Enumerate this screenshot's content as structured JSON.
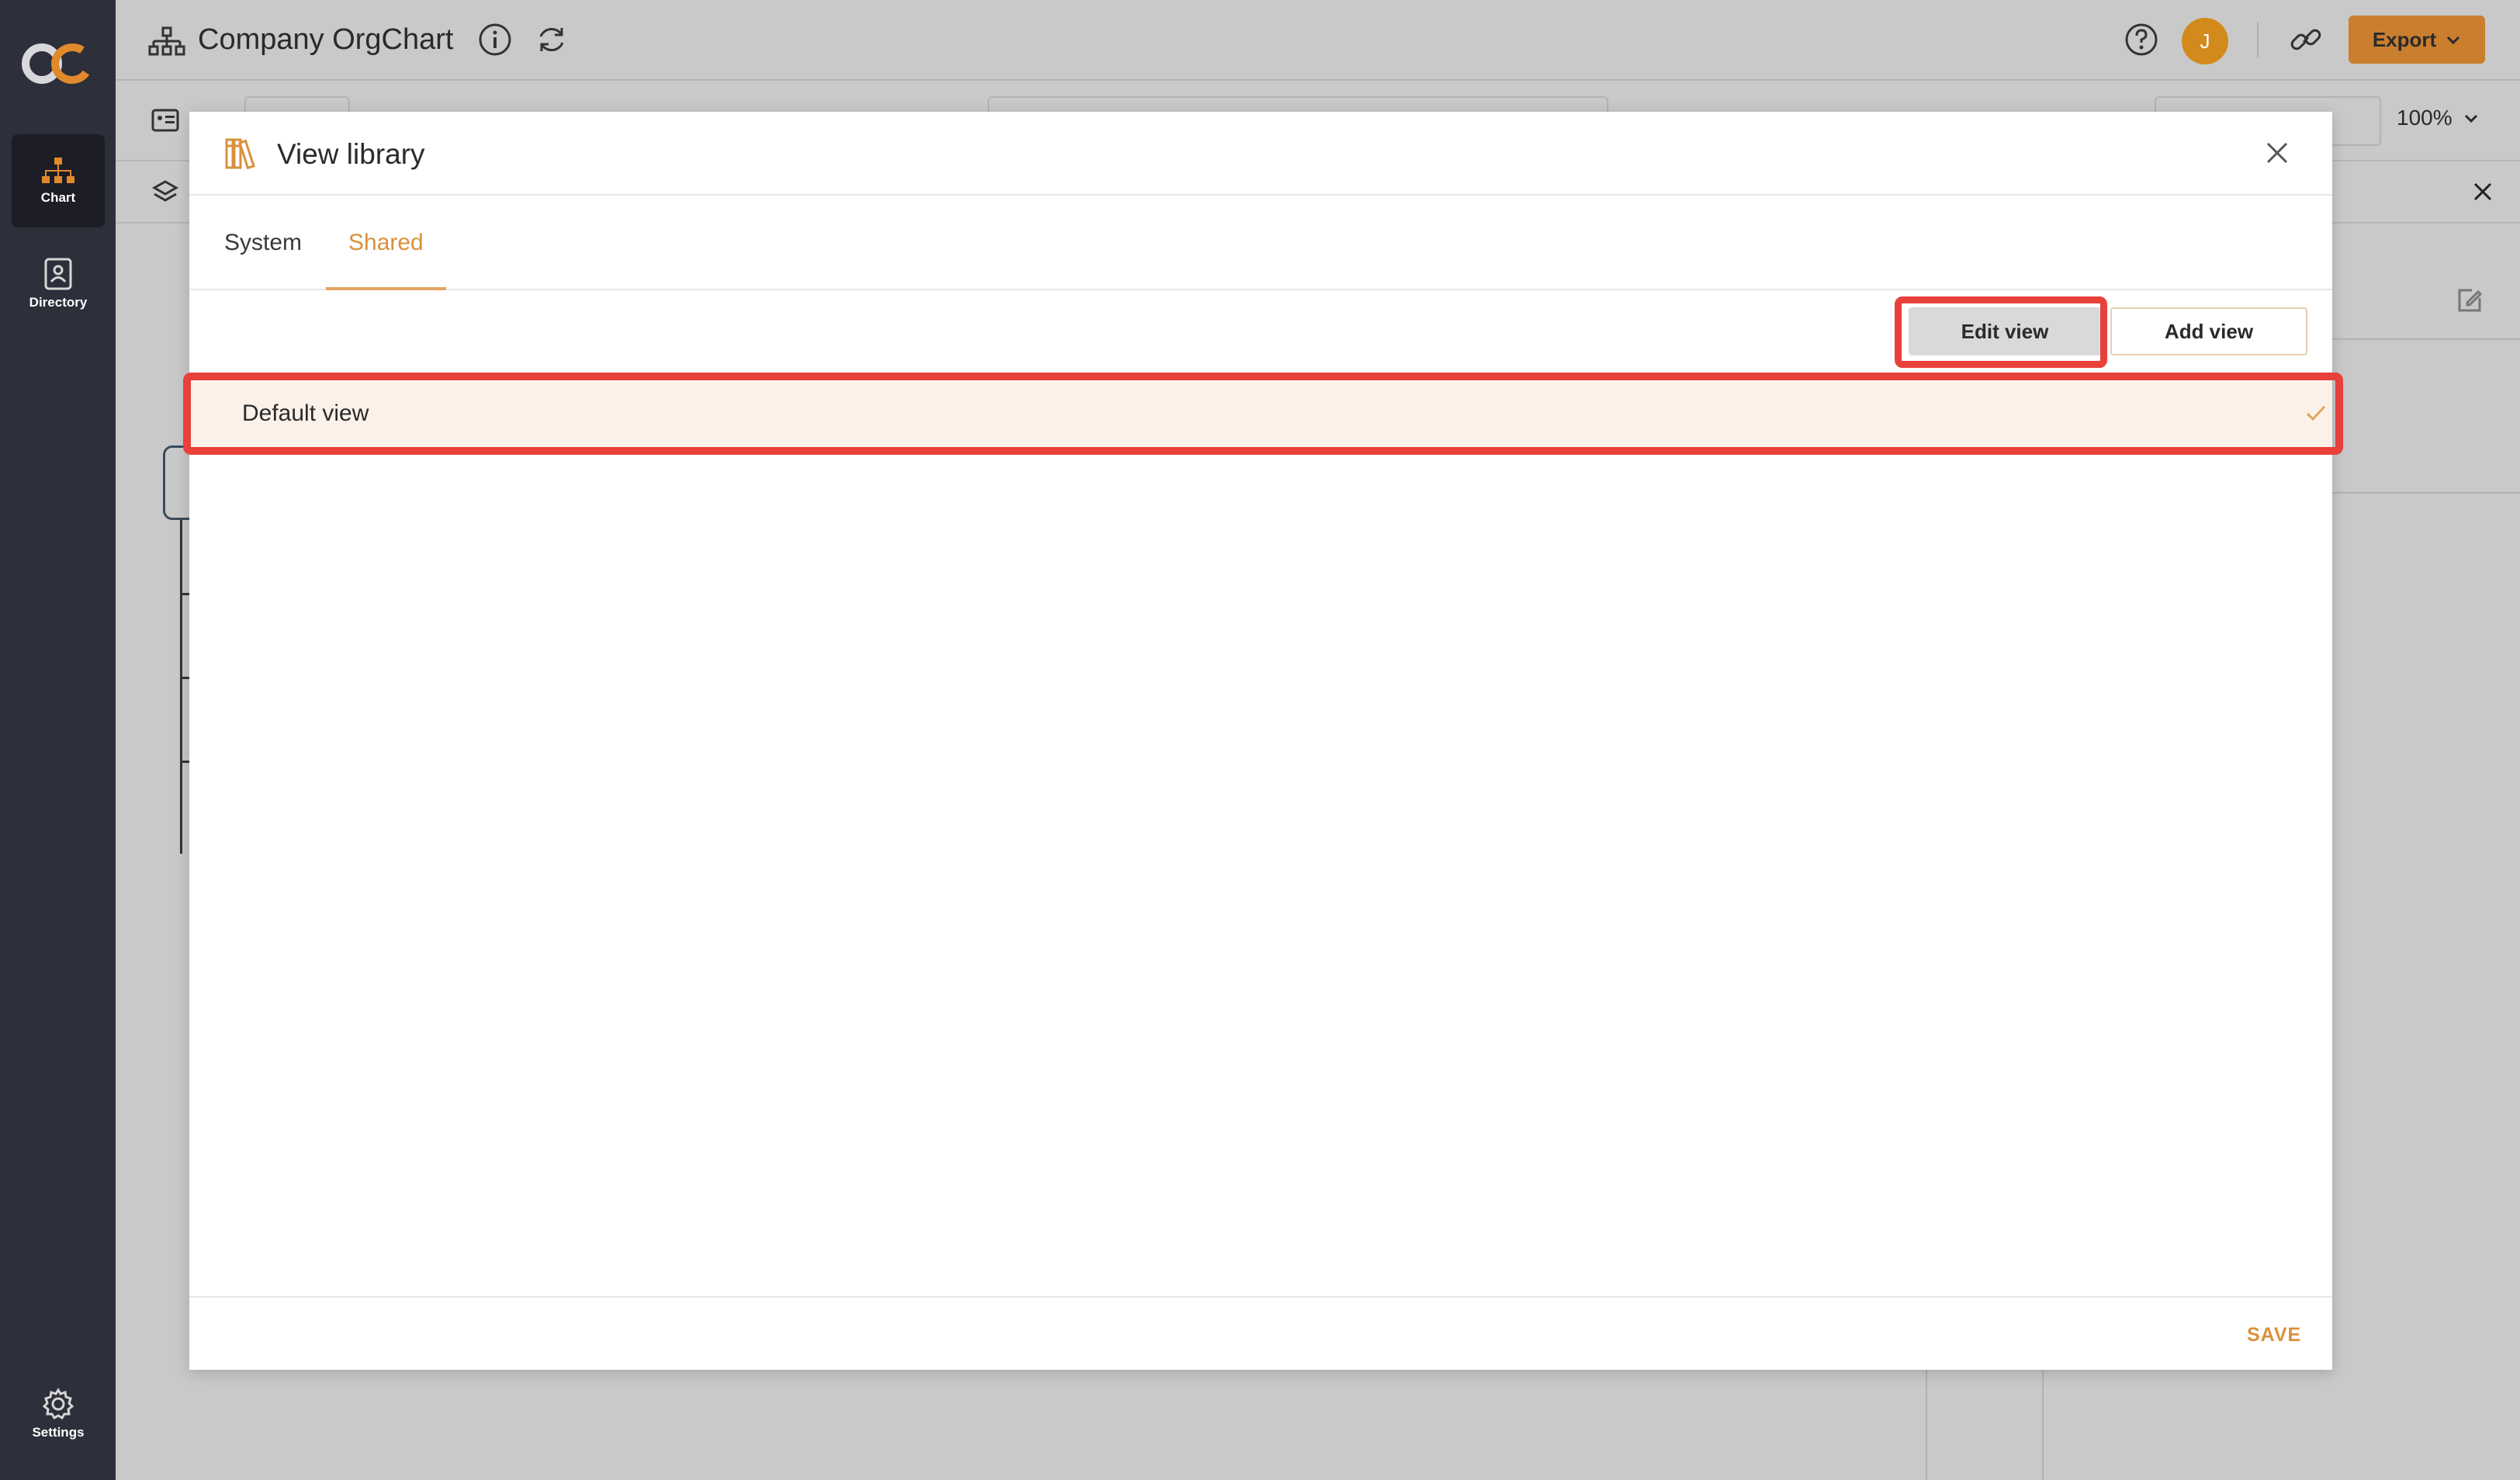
{
  "sidebar": {
    "items": [
      {
        "label": "Chart",
        "icon": "org-chart-icon",
        "active": true
      },
      {
        "label": "Directory",
        "icon": "contact-book-icon",
        "active": false
      },
      {
        "label": "Settings",
        "icon": "gear-icon",
        "active": false
      }
    ]
  },
  "header": {
    "title": "Company OrgChart",
    "avatar_initial": "J",
    "export_label": "Export",
    "zoom_level": "100%"
  },
  "modal": {
    "title": "View library",
    "tabs": [
      {
        "label": "System",
        "active": false
      },
      {
        "label": "Shared",
        "active": true
      }
    ],
    "edit_view_label": "Edit view",
    "add_view_label": "Add view",
    "views": [
      {
        "label": "Default view",
        "selected": true
      }
    ],
    "save_label": "SAVE"
  },
  "colors": {
    "accent": "#d8913d",
    "rail_bg": "#2d2f3b",
    "export_bg": "#c97f2e",
    "highlight": "#e8403a",
    "selected_row_bg": "#fbf1e9"
  }
}
